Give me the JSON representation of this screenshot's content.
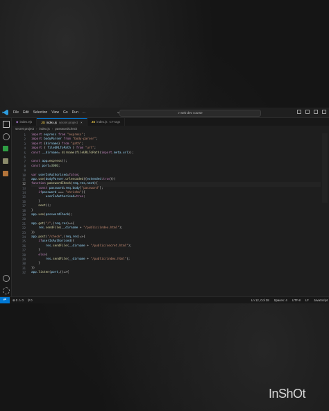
{
  "menu": [
    "File",
    "Edit",
    "Selection",
    "View",
    "Go",
    "Run",
    "..."
  ],
  "search": {
    "placeholder": "web dev course"
  },
  "tabs": [
    {
      "label": "index.ejs",
      "desc": "",
      "active": false
    },
    {
      "label": "index.js",
      "desc": "secret project",
      "active": true
    },
    {
      "label": "index.js",
      "desc": "CT-tags",
      "active": false
    }
  ],
  "breadcrumb": [
    "secret project",
    "index.js",
    "passwordCheck"
  ],
  "code": [
    {
      "n": "1",
      "t": "import express from \"express\";"
    },
    {
      "n": "2",
      "t": "import bodyParser from \"body-parser\";"
    },
    {
      "n": "3",
      "t": "import {dirname} from \"path\";"
    },
    {
      "n": "4",
      "t": "import { fileURLToPath } from \"url\";"
    },
    {
      "n": "5",
      "t": "const __dirname= dirname(fileURLToPath(import.meta.url));"
    },
    {
      "n": "6",
      "t": ""
    },
    {
      "n": "7",
      "t": "const app=express();"
    },
    {
      "n": "8",
      "t": "const port=3000;"
    },
    {
      "n": "9",
      "t": ""
    },
    {
      "n": "10",
      "t": "var userIsAuthorised=false;"
    },
    {
      "n": "11",
      "t": "app.use(bodyParser.urlencoded({extended:true}))"
    },
    {
      "n": "12",
      "t": "function passwordCheck(req,res,next){"
    },
    {
      "n": "13",
      "t": "    const password=req.body[\"password\"];"
    },
    {
      "n": "14",
      "t": "    if (password === \"shrisha\"){"
    },
    {
      "n": "15",
      "t": "        userIsAuthorised=true;"
    },
    {
      "n": "16",
      "t": "    }"
    },
    {
      "n": "17",
      "t": "    next();"
    },
    {
      "n": "18",
      "t": "}"
    },
    {
      "n": "19",
      "t": "app.use(passwordCheck);"
    },
    {
      "n": "20",
      "t": ""
    },
    {
      "n": "21",
      "t": "app.get(\"/\",(req,res)=>{"
    },
    {
      "n": "22",
      "t": "    res.sendFile(__dirname + \"/public/index.html\");"
    },
    {
      "n": "23",
      "t": "})"
    },
    {
      "n": "24",
      "t": "app.post(\"/check\",(req,res)=>{"
    },
    {
      "n": "25",
      "t": "    if(userIsAuthorised){"
    },
    {
      "n": "26",
      "t": "        res.sendFile(__dirname + \"/public/secret.html\");"
    },
    {
      "n": "27",
      "t": "    }"
    },
    {
      "n": "28",
      "t": "    else{"
    },
    {
      "n": "29",
      "t": "        res.sendFile(__dirname + \"/public/index.html\");"
    },
    {
      "n": "30",
      "t": "    }"
    },
    {
      "n": "31",
      "t": "})"
    },
    {
      "n": "32",
      "t": "app.listen(port,()=>{"
    }
  ],
  "current_line": "12",
  "status": {
    "errors": "0",
    "warnings": "0",
    "ports": "0",
    "position": "Ln 12, Col 38",
    "spaces": "Spaces: 4",
    "encoding": "UTF-8",
    "eol": "LF",
    "language": "JavaScript"
  },
  "watermark": "InShOt",
  "colors": {
    "accent": "#0078d4",
    "background": "#1e1e1e"
  }
}
